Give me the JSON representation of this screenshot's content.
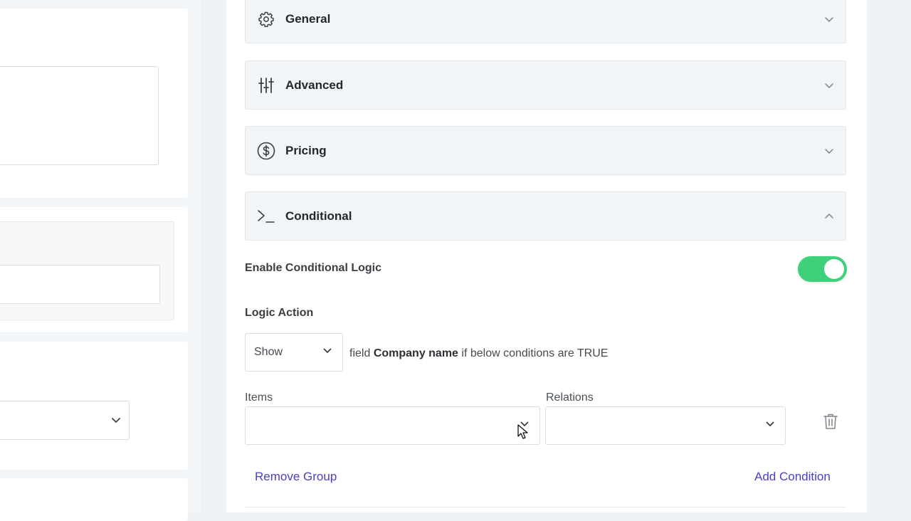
{
  "accordions": [
    {
      "label": "General",
      "icon": "gear-icon",
      "expanded": false
    },
    {
      "label": "Advanced",
      "icon": "sliders-icon",
      "expanded": false
    },
    {
      "label": "Pricing",
      "icon": "dollar-icon",
      "expanded": false
    },
    {
      "label": "Conditional",
      "icon": "terminal-icon",
      "expanded": true
    }
  ],
  "conditional": {
    "enable_label": "Enable Conditional Logic",
    "enabled": true,
    "toggle_color": "#3fd07c",
    "logic_action_label": "Logic Action",
    "action_value": "Show",
    "sentence_prefix": "field",
    "field_name": "Company name",
    "sentence_suffix": "if below conditions are TRUE",
    "items_label": "Items",
    "items_value": "",
    "relations_label": "Relations",
    "relations_value": "",
    "remove_group": "Remove Group",
    "add_condition": "Add Condition"
  },
  "colors": {
    "accent_link": "#4b3fc1",
    "toggle_on": "#3fd07c"
  }
}
